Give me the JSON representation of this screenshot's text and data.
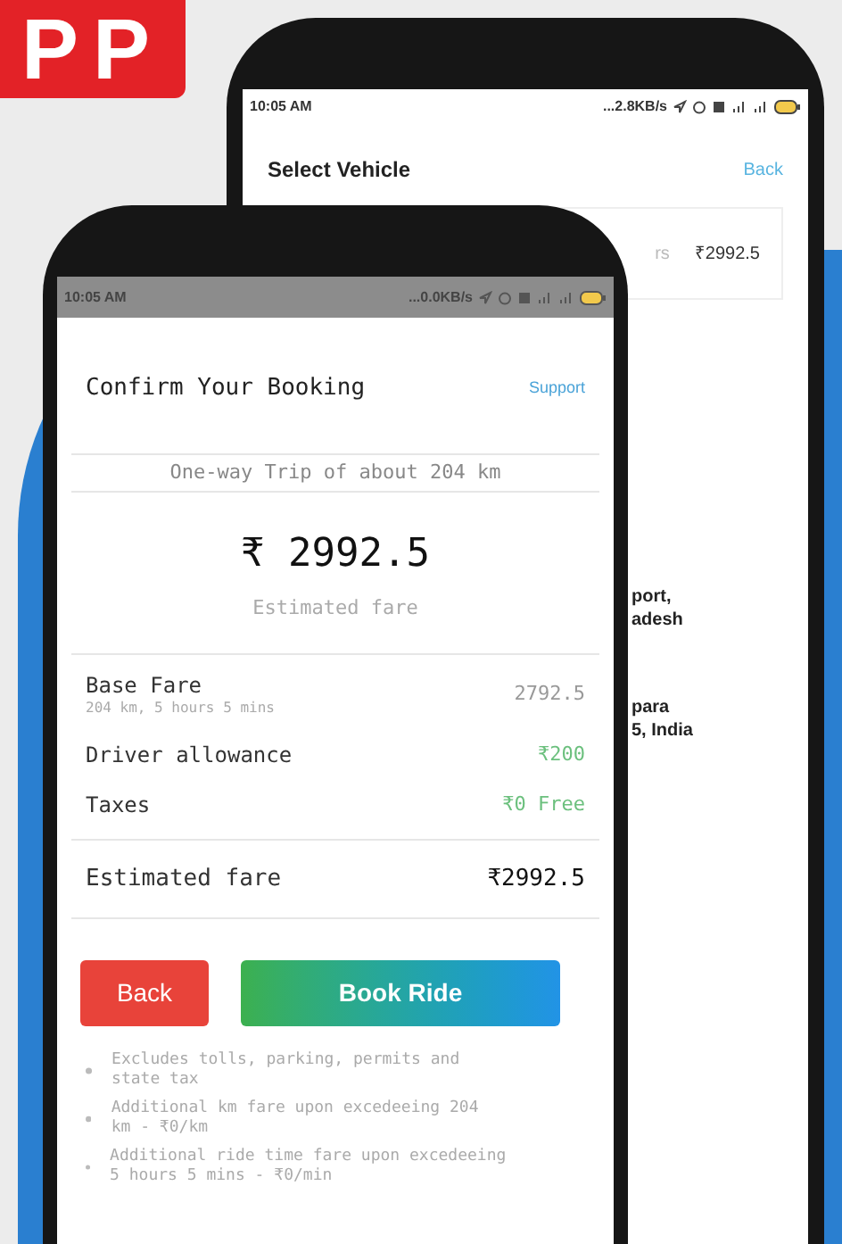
{
  "banner": {
    "text": "PP"
  },
  "back_phone": {
    "status_bar": {
      "time": "10:05 AM",
      "speed": "...2.8KB/s"
    },
    "title": "Select Vehicle",
    "action": "Back",
    "vehicle_card": {
      "column_1": "rs",
      "price": "₹2992.5"
    },
    "addresses": [
      {
        "lines": [
          "port,",
          "adesh"
        ]
      },
      {
        "lines": [
          "para",
          "5, India"
        ]
      }
    ]
  },
  "front_phone": {
    "status_bar": {
      "time": "10:05 AM",
      "speed": "...0.0KB/s"
    },
    "title": "Confirm Your Booking",
    "action": "Support",
    "trip": "One-way Trip of about 204 km",
    "total": "₹ 2992.5",
    "total_label": "Estimated fare",
    "breakdown": [
      {
        "label": "Base Fare",
        "sublabel": "204 km, 5 hours 5 mins",
        "value": "2792.5",
        "kind": "plain"
      },
      {
        "label": "Driver allowance",
        "value": "₹200",
        "kind": "credit"
      },
      {
        "label": "Taxes",
        "value": "₹0 Free",
        "kind": "credit"
      }
    ],
    "estimate": {
      "label": "Estimated fare",
      "value": "₹2992.5"
    },
    "buttons": [
      {
        "label": "Back",
        "kind": "cancel"
      },
      {
        "label": "Book Ride",
        "kind": "primary"
      }
    ],
    "notes": [
      "Excludes tolls, parking, permits and state tax",
      "Additional km fare upon excedeeing 204 km - ₹0/km",
      "Additional ride time fare upon excedeeing 5 hours 5 mins - ₹0/min"
    ]
  }
}
